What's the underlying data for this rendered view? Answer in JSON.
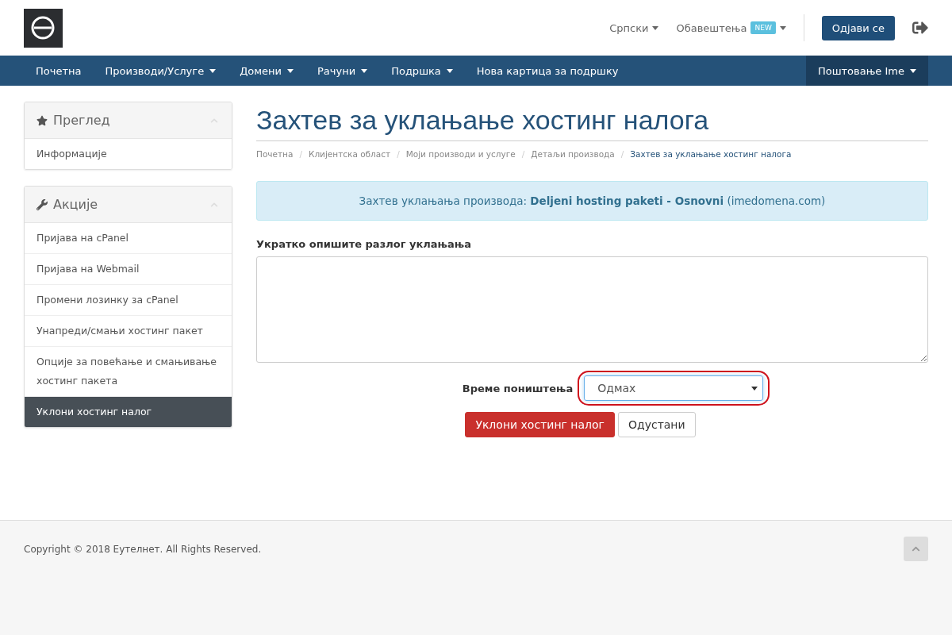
{
  "header": {
    "language": {
      "label": "Српски",
      "dropdown": true
    },
    "notifications": {
      "label": "Обавештења",
      "badge": "NEW",
      "dropdown": true
    },
    "logout_button": "Одјави се"
  },
  "nav": {
    "items": [
      {
        "label": "Почетна",
        "dropdown": false
      },
      {
        "label": "Производи/Услуге",
        "dropdown": true
      },
      {
        "label": "Домени",
        "dropdown": true
      },
      {
        "label": "Рачуни",
        "dropdown": true
      },
      {
        "label": "Подршка",
        "dropdown": true
      },
      {
        "label": "Нова картица за подршку",
        "dropdown": false
      }
    ],
    "account": {
      "label": "Поштовање Ime",
      "dropdown": true
    }
  },
  "sidebar": {
    "panels": [
      {
        "title": "Преглед",
        "expanded": true,
        "items": [
          {
            "label": "Информације",
            "selected": false
          }
        ]
      },
      {
        "title": "Акције",
        "expanded": true,
        "items": [
          {
            "label": "Пријава на cPanel",
            "selected": false
          },
          {
            "label": "Пријава на Webmail",
            "selected": false
          },
          {
            "label": "Промени лозинку за cPanel",
            "selected": false
          },
          {
            "label": "Унапреди/смањи хостинг пакет",
            "selected": false
          },
          {
            "label": "Опције за повећање и смањивање хостинг пакета",
            "selected": false
          },
          {
            "label": "Уклони хостинг налог",
            "selected": true
          }
        ]
      }
    ]
  },
  "page_title": "Захтев за уклањање хостинг налога",
  "breadcrumb": [
    {
      "label": "Почетна",
      "current": false
    },
    {
      "separator": "/",
      "label": "Клијентска област",
      "current": false
    },
    {
      "separator": "/",
      "label": "Моји производи и услуге",
      "current": false
    },
    {
      "separator": "/",
      "label": "Детаљи производа",
      "current": false
    },
    {
      "separator": "/",
      "label": "Захтев за уклањање хостинг налога",
      "current": true
    }
  ],
  "alert": "Захтев уклањања производа: **Deljeni hosting paketi - Osnovni** (imedomena.com)",
  "form": {
    "reason_label": "Укратко опишите разлог уклањања",
    "cancel_time_label": "Време поништења",
    "cancel_time": {
      "value": "Одмах",
      "highlighted": true
    },
    "buttons": [
      {
        "label": "Уклони хостинг налог",
        "kind": "danger"
      },
      {
        "label": "Одустани",
        "kind": "default"
      }
    ]
  },
  "footer": {
    "copyright": "Copyright © 2018 Еутелнет. All Rights Reserved."
  }
}
